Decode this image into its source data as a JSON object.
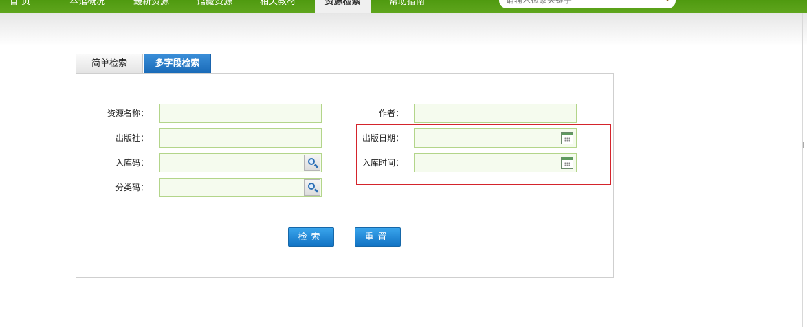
{
  "nav": {
    "items": [
      "首 页",
      "本馆概况",
      "最新资源",
      "馆藏资源",
      "相关教材",
      "资源检索",
      "帮助指南"
    ],
    "active": "资源检索",
    "search_placeholder": "请输入检索关键字"
  },
  "tabs": {
    "simple": "简单检索",
    "multi": "多字段检索"
  },
  "form": {
    "resource_name": "资源名称：",
    "author": "作者：",
    "publisher": "出版社：",
    "publish_date": "出版日期：",
    "accession_code": "入库码：",
    "accession_time": "入库时间：",
    "category_code": "分类码："
  },
  "buttons": {
    "search": "检索",
    "reset": "重置"
  },
  "colors": {
    "nav_green": "#5fa51d",
    "tab_active_blue": "#1a6bb8",
    "button_blue": "#1273c4",
    "field_border": "#b3d58a",
    "highlight_red": "#d4242c"
  }
}
